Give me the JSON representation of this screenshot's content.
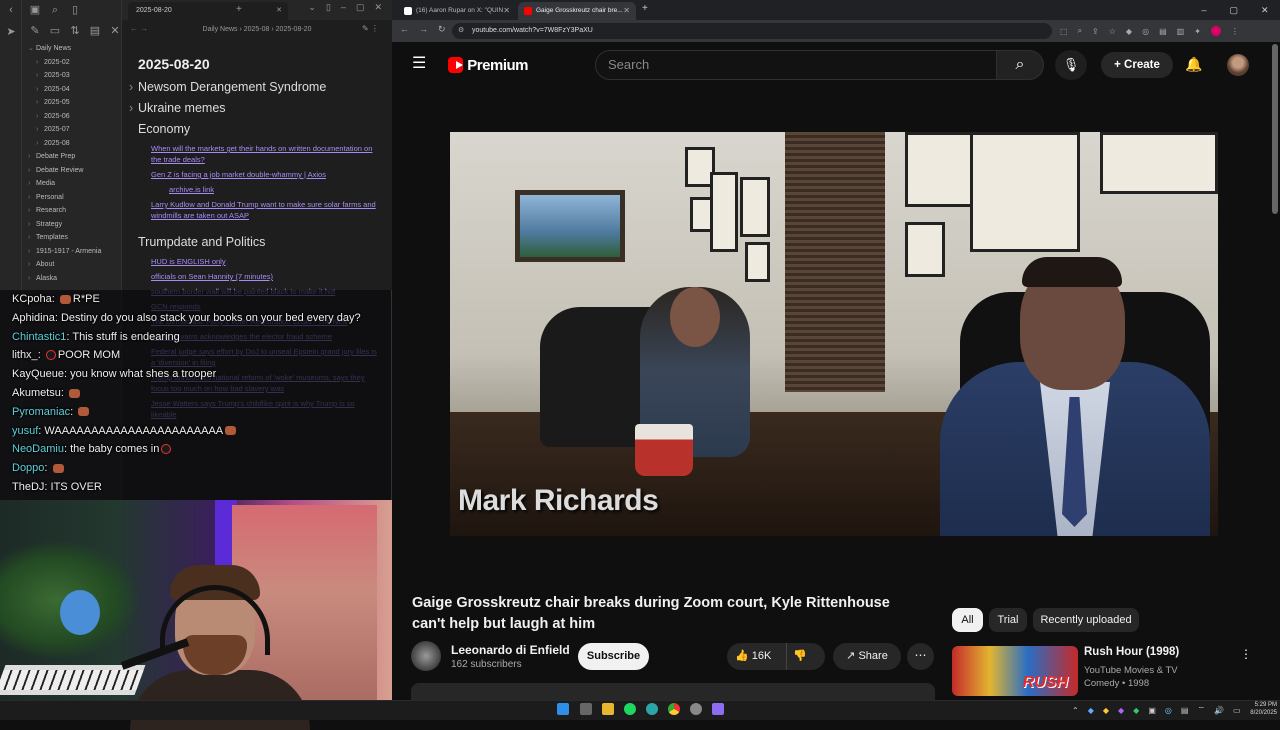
{
  "obsidian": {
    "tab_title": "2025-08-20",
    "breadcrumb": "Daily News › 2025-08 › 2025-08-20",
    "tree": [
      {
        "label": "Daily News",
        "indent": 0,
        "open": true
      },
      {
        "label": "2025-02",
        "indent": 1
      },
      {
        "label": "2025-03",
        "indent": 1
      },
      {
        "label": "2025-04",
        "indent": 1
      },
      {
        "label": "2025-05",
        "indent": 1
      },
      {
        "label": "2025-06",
        "indent": 1
      },
      {
        "label": "2025-07",
        "indent": 1
      },
      {
        "label": "2025-08",
        "indent": 1
      },
      {
        "label": "Debate Prep",
        "indent": 0
      },
      {
        "label": "Debate Review",
        "indent": 0
      },
      {
        "label": "Media",
        "indent": 0
      },
      {
        "label": "Personal",
        "indent": 0
      },
      {
        "label": "Research",
        "indent": 0
      },
      {
        "label": "Strategy",
        "indent": 0
      },
      {
        "label": "Templates",
        "indent": 0
      },
      {
        "label": "1915-1917 - Armenia",
        "indent": 0
      },
      {
        "label": "About",
        "indent": 0
      },
      {
        "label": "Alaska",
        "indent": 0
      }
    ],
    "note": {
      "title": "2025-08-20",
      "folded_headings": [
        "Newsom Derangement Syndrome",
        "Ukraine memes"
      ],
      "economy_heading": "Economy",
      "economy_links": [
        {
          "text": "When will the markets get their hands on written documentation on the trade deals?",
          "sub": false
        },
        {
          "text": "Gen Z is facing a job market double-whammy | Axios",
          "sub": false
        },
        {
          "text": "archive.is link",
          "sub": true
        },
        {
          "text": "Larry Kudlow and Donald Trump want to make sure solar farms and windmills are taken out ASAP",
          "sub": false
        }
      ],
      "trump_heading": "Trumpdate and Politics",
      "trump_links": [
        "HUD is ENGLISH only",
        "officials on Sean Hannity (7 minutes)",
        "southern border wall will be painted black to make it hot",
        "GCN responds",
        "The Democratic Party's Voter Registration Crisis - The New",
        "Peter Navarro acknowledges the elector fraud scheme",
        "Federal judge says effort by DoJ to unseal Epstein grand jury files is a 'diversion' in filing",
        "Trump announces national reform of 'woke' museums, says they focus too much on how bad slavery was",
        "Jesse Watters says Trump's childlike spirit is why Trump is so likeable"
      ]
    }
  },
  "chat": [
    {
      "user": "KCpoha",
      "color": "white",
      "text": "R*PE",
      "emote": "pre"
    },
    {
      "user": "Aphidina",
      "color": "white",
      "text": "Destiny do you also stack your books on your bed every day?"
    },
    {
      "user": "Chintastic1",
      "color": "cyan",
      "text": "This stuff is endearing"
    },
    {
      "user": "lithx_",
      "color": "white",
      "text": "POOR MOM",
      "emote": "pre-circle"
    },
    {
      "user": "KayQueue",
      "color": "white",
      "text": "you know what shes a trooper"
    },
    {
      "user": "Akumetsu",
      "color": "white",
      "text": "",
      "emote": "post"
    },
    {
      "user": "Pyromaniac",
      "color": "cyan",
      "text": "",
      "emote": "post"
    },
    {
      "user": "yusuf",
      "color": "cyan",
      "text": "WAAAAAAAAAAAAAAAAAAAAAAA",
      "emote": "post"
    },
    {
      "user": "NeoDamiu",
      "color": "cyan",
      "text": "the baby comes in",
      "emote": "post-circle"
    },
    {
      "user": "Doppo",
      "color": "cyan",
      "text": "",
      "emote": "post"
    },
    {
      "user": "TheDJ",
      "color": "white",
      "text": "ITS OVER"
    }
  ],
  "browser": {
    "tabs": [
      {
        "title": "(16) Aaron Rupar on X: \"QUIN",
        "favicon_color": "#ffffff",
        "active": false
      },
      {
        "title": "Gaige Grosskreutz chair bre...",
        "favicon_color": "#ff0000",
        "active": true
      }
    ],
    "url": "youtube.com/watch?v=7W8FzY3PaXU"
  },
  "youtube": {
    "logo_text": "Premium",
    "search_placeholder": "Search",
    "create_label": "Create",
    "video_caption": "Mark Richards",
    "title": "Gaige Grosskreutz chair breaks during Zoom court, Kyle Rittenhouse can't help but laugh at him",
    "channel_name": "Leeonardo di Enfield",
    "subscribers": "162 subscribers",
    "subscribe_label": "Subscribe",
    "likes": "16K",
    "share_label": "Share",
    "chips": [
      "All",
      "Trial",
      "Recently uploaded"
    ],
    "recommendation": {
      "title": "Rush Hour (1998)",
      "channel": "YouTube Movies & TV",
      "meta": "Comedy • 1998",
      "thumb_text": "RUSH"
    },
    "accent_color": "#ff0000"
  },
  "taskbar": {
    "time": "5:29 PM",
    "date": "8/20/2025"
  }
}
